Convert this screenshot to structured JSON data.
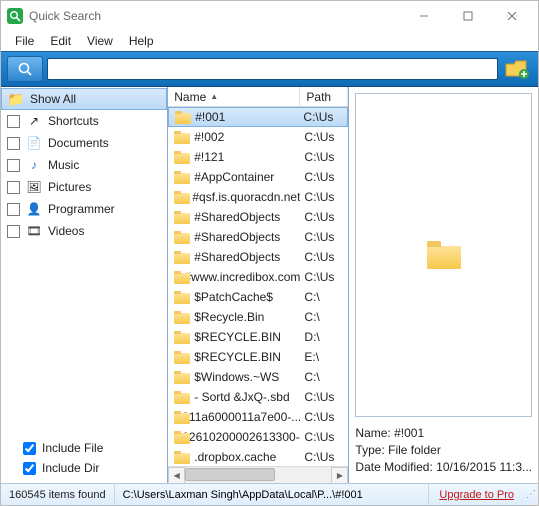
{
  "window": {
    "title": "Quick Search"
  },
  "menu": {
    "items": [
      "File",
      "Edit",
      "View",
      "Help"
    ]
  },
  "search": {
    "value": "",
    "placeholder": ""
  },
  "sidebar": {
    "items": [
      {
        "label": "Show All",
        "active": true,
        "checkbox": false,
        "icon": "folder-tree"
      },
      {
        "label": "Shortcuts",
        "active": false,
        "checkbox": true,
        "icon": "shortcut"
      },
      {
        "label": "Documents",
        "active": false,
        "checkbox": true,
        "icon": "document"
      },
      {
        "label": "Music",
        "active": false,
        "checkbox": true,
        "icon": "music"
      },
      {
        "label": "Pictures",
        "active": false,
        "checkbox": true,
        "icon": "pictures"
      },
      {
        "label": "Programmer",
        "active": false,
        "checkbox": true,
        "icon": "programmer"
      },
      {
        "label": "Videos",
        "active": false,
        "checkbox": true,
        "icon": "videos"
      }
    ],
    "include_file": {
      "label": "Include File",
      "checked": true
    },
    "include_dir": {
      "label": "Include Dir",
      "checked": true
    }
  },
  "list": {
    "columns": {
      "name": "Name",
      "path": "Path"
    },
    "sort": {
      "column": "name",
      "dir": "asc"
    },
    "rows": [
      {
        "name": "#!001",
        "path": "C:\\Us",
        "selected": true
      },
      {
        "name": "#!002",
        "path": "C:\\Us"
      },
      {
        "name": "#!121",
        "path": "C:\\Us"
      },
      {
        "name": "#AppContainer",
        "path": "C:\\Us"
      },
      {
        "name": "#qsf.is.quoracdn.net",
        "path": "C:\\Us"
      },
      {
        "name": "#SharedObjects",
        "path": "C:\\Us"
      },
      {
        "name": "#SharedObjects",
        "path": "C:\\Us"
      },
      {
        "name": "#SharedObjects",
        "path": "C:\\Us"
      },
      {
        "name": "#www.incredibox.com",
        "path": "C:\\Us"
      },
      {
        "name": "$PatchCache$",
        "path": "C:\\"
      },
      {
        "name": "$Recycle.Bin",
        "path": "C:\\"
      },
      {
        "name": "$RECYCLE.BIN",
        "path": "D:\\"
      },
      {
        "name": "$RECYCLE.BIN",
        "path": "E:\\"
      },
      {
        "name": "$Windows.~WS",
        "path": "C:\\"
      },
      {
        "name": "- Sortd &JxQ-.sbd",
        "path": "C:\\Us"
      },
      {
        "name": "-011a6000011a7e00-...",
        "path": "C:\\Us"
      },
      {
        "name": "-02610200002613300-...",
        "path": "C:\\Us"
      },
      {
        "name": ".dropbox.cache",
        "path": "C:\\Us"
      }
    ]
  },
  "preview": {
    "name_label": "Name:",
    "name_value": "#!001",
    "type_label": "Type:",
    "type_value": "File folder",
    "date_label": "Date Modified:",
    "date_value": "10/16/2015 11:3..."
  },
  "status": {
    "count_text": "160545 items found",
    "path_text": "C:\\Users\\Laxman Singh\\AppData\\Local\\P...\\#!001",
    "upgrade_text": "Upgrade to Pro"
  }
}
